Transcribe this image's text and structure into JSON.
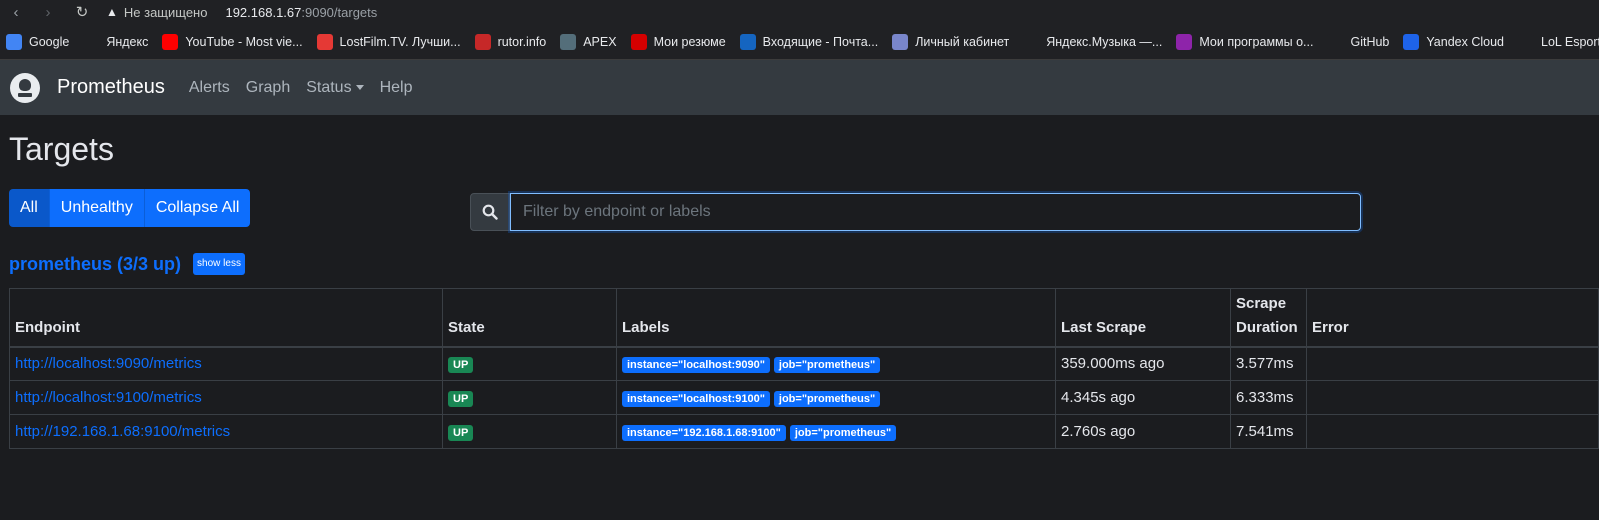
{
  "browser": {
    "insecure_label": "Не защищено",
    "url_host": "192.168.1.67",
    "url_rest": ":9090/targets",
    "bookmarks": [
      {
        "label": "Google",
        "icon": "google-icon",
        "color": "#4285f4"
      },
      {
        "label": "Яндекс",
        "icon": "yandex-star-icon",
        "color": "#202124"
      },
      {
        "label": "YouTube - Most vie...",
        "icon": "youtube-icon",
        "color": "#ff0000"
      },
      {
        "label": "LostFilm.TV. Лучши...",
        "icon": "lostfilm-icon",
        "color": "#e53935"
      },
      {
        "label": "rutor.info",
        "icon": "rutor-icon",
        "color": "#c62828"
      },
      {
        "label": "APEX",
        "icon": "apex-icon",
        "color": "#546e7a"
      },
      {
        "label": "Мои резюме",
        "icon": "hh-icon",
        "color": "#d50000"
      },
      {
        "label": "Входящие - Почта...",
        "icon": "mail-icon",
        "color": "#1565c0"
      },
      {
        "label": "Личный кабинет",
        "icon": "cabinet-icon",
        "color": "#7986cb"
      },
      {
        "label": "Яндекс.Музыка —...",
        "icon": "music-play-icon",
        "color": "#202124"
      },
      {
        "label": "Мои программы о...",
        "icon": "programs-icon",
        "color": "#8e24aa"
      },
      {
        "label": "GitHub",
        "icon": "github-icon",
        "color": "#202124"
      },
      {
        "label": "Yandex Cloud",
        "icon": "yandex-cloud-icon",
        "color": "#1e63e9"
      },
      {
        "label": "LoL Esports RU",
        "icon": "lol-icon",
        "color": "#202124"
      }
    ]
  },
  "nav": {
    "brand": "Prometheus",
    "links": [
      "Alerts",
      "Graph",
      "Status",
      "Help"
    ]
  },
  "page": {
    "title": "Targets",
    "filters": [
      "All",
      "Unhealthy",
      "Collapse All"
    ],
    "search_placeholder": "Filter by endpoint or labels"
  },
  "job": {
    "title": "prometheus (3/3 up)",
    "toggle": "show less",
    "columns": [
      "Endpoint",
      "State",
      "Labels",
      "Last Scrape",
      "Scrape Duration",
      "Error"
    ],
    "rows": [
      {
        "endpoint": "http://localhost:9090/metrics",
        "state": "UP",
        "labels": [
          "instance=\"localhost:9090\"",
          "job=\"prometheus\""
        ],
        "last_scrape": "359.000ms ago",
        "duration": "3.577ms",
        "error": ""
      },
      {
        "endpoint": "http://localhost:9100/metrics",
        "state": "UP",
        "labels": [
          "instance=\"localhost:9100\"",
          "job=\"prometheus\""
        ],
        "last_scrape": "4.345s ago",
        "duration": "6.333ms",
        "error": ""
      },
      {
        "endpoint": "http://192.168.1.68:9100/metrics",
        "state": "UP",
        "labels": [
          "instance=\"192.168.1.68:9100\"",
          "job=\"prometheus\""
        ],
        "last_scrape": "2.760s ago",
        "duration": "7.541ms",
        "error": ""
      }
    ]
  },
  "colors": {
    "accent": "#0d6efd",
    "up": "#198754",
    "navbar": "#343a40",
    "background": "#1b1c1f"
  }
}
